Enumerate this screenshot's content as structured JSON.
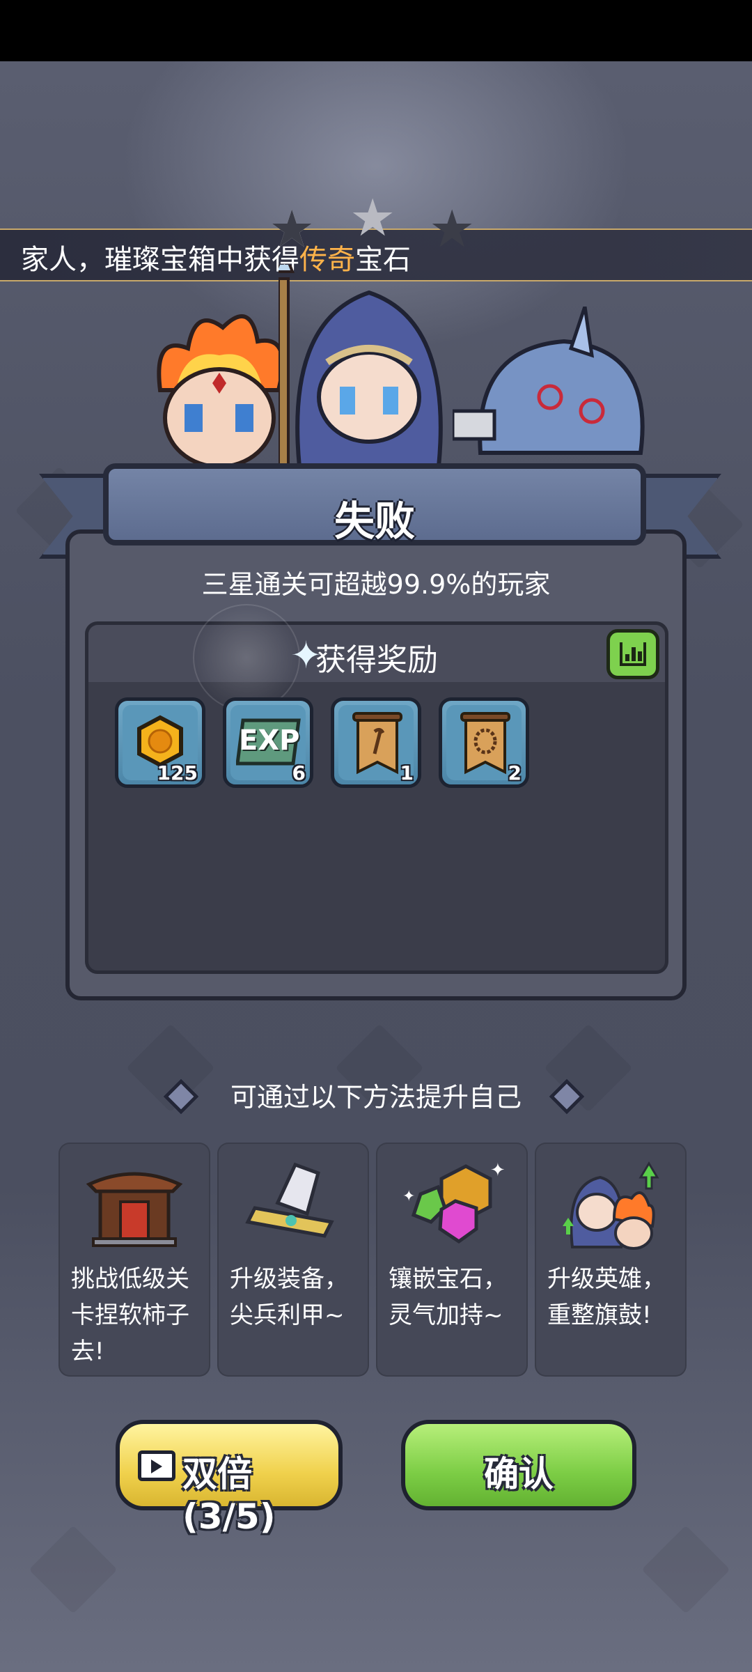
{
  "ticker": {
    "prefix": "家人，璀璨宝箱中获得",
    "highlight": "传奇",
    "suffix": "宝石"
  },
  "stars": {
    "earned": 0,
    "total": 3
  },
  "result": {
    "title": "失败",
    "subtitle": "三星通关可超越99.9%的玩家"
  },
  "rewards": {
    "title": "获得奖励",
    "items": [
      {
        "icon": "gold-coin-icon",
        "count": "125"
      },
      {
        "icon": "exp-icon",
        "label": "EXP",
        "count": "6"
      },
      {
        "icon": "staff-scroll-icon",
        "count": "1"
      },
      {
        "icon": "necklace-scroll-icon",
        "count": "2"
      }
    ]
  },
  "tips": {
    "heading": "可通过以下方法提升自己",
    "cards": [
      {
        "icon": "pagoda-gate-icon",
        "text": "挑战低级关卡捏软柿子去!"
      },
      {
        "icon": "sword-upgrade-icon",
        "text": "升级装备，尖兵利甲~"
      },
      {
        "icon": "gems-icon",
        "text": "镶嵌宝石，灵气加持~"
      },
      {
        "icon": "heroes-upgrade-icon",
        "text": "升级英雄，重整旗鼓!"
      }
    ]
  },
  "buttons": {
    "double": "双倍(3/5)",
    "confirm": "确认"
  },
  "colors": {
    "highlight": "#ffb34a",
    "confirm_green": "#7ccd45",
    "double_yellow": "#f0d14c",
    "item_blue": "#5a97b9"
  }
}
